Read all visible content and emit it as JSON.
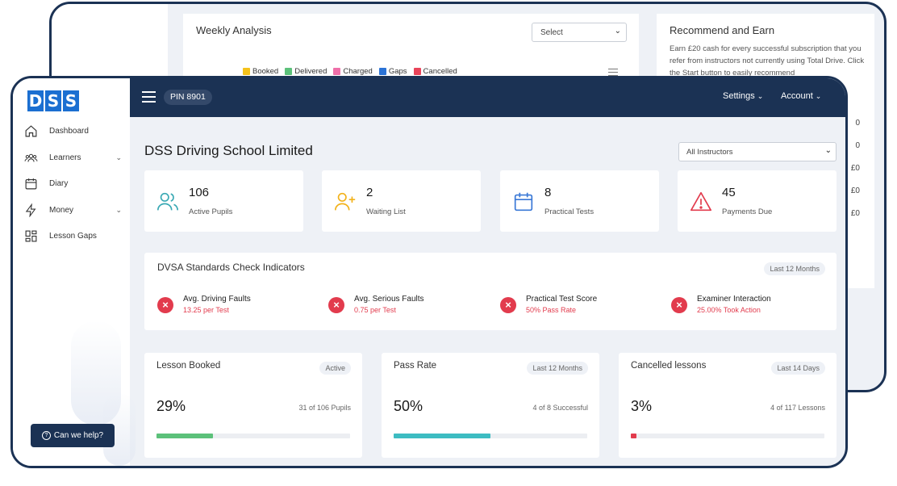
{
  "back": {
    "weekly": {
      "title": "Weekly Analysis",
      "select": "Select",
      "legend": [
        {
          "label": "Booked",
          "color": "#f5c21b"
        },
        {
          "label": "Delivered",
          "color": "#5cc17a"
        },
        {
          "label": "Charged",
          "color": "#ef6fa9"
        },
        {
          "label": "Gaps",
          "color": "#2b73d6"
        },
        {
          "label": "Cancelled",
          "color": "#e9445a"
        }
      ]
    },
    "recommend": {
      "title": "Recommend and Earn",
      "body": "Earn £20 cash for every successful subscription that you refer from instructors not currently using Total Drive. Click the Start button to easily recommend",
      "values": [
        "0",
        "0",
        "£0",
        "£0",
        "£0"
      ]
    }
  },
  "sidebar": {
    "logo": [
      "D",
      "S",
      "S"
    ],
    "items": [
      {
        "label": "Dashboard",
        "icon": "home-icon",
        "chevron": false
      },
      {
        "label": "Learners",
        "icon": "users-icon",
        "chevron": true
      },
      {
        "label": "Diary",
        "icon": "calendar-icon",
        "chevron": false
      },
      {
        "label": "Money",
        "icon": "lightning-icon",
        "chevron": true
      },
      {
        "label": "Lesson Gaps",
        "icon": "grid-icon",
        "chevron": false
      }
    ],
    "help": "Can we help?"
  },
  "topbar": {
    "pin": "PIN 8901",
    "settings": "Settings",
    "account": "Account"
  },
  "main": {
    "title": "DSS Driving School Limited",
    "instructor_select": "All Instructors",
    "stats": [
      {
        "value": "106",
        "label": "Active Pupils",
        "icon": "users-icon",
        "color": "#3aa9b4"
      },
      {
        "value": "2",
        "label": "Waiting List",
        "icon": "user-plus-icon",
        "color": "#f2b21b"
      },
      {
        "value": "8",
        "label": "Practical Tests",
        "icon": "calendar-icon",
        "color": "#3a78d6"
      },
      {
        "value": "45",
        "label": "Payments Due",
        "icon": "warning-icon",
        "color": "#e23b4d"
      }
    ],
    "dvsa": {
      "title": "DVSA Standards Check Indicators",
      "period": "Last 12 Months",
      "indicators": [
        {
          "label": "Avg. Driving Faults",
          "value": "13.25 per Test"
        },
        {
          "label": "Avg. Serious Faults",
          "value": "0.75 per Test"
        },
        {
          "label": "Practical Test Score",
          "value": "50% Pass Rate"
        },
        {
          "label": "Examiner Interaction",
          "value": "25.00% Took Action"
        }
      ]
    },
    "metrics": [
      {
        "title": "Lesson Booked",
        "badge": "Active",
        "percent": "29%",
        "detail": "31 of 106 Pupils",
        "fill": 0.29,
        "color": "#5cc17a"
      },
      {
        "title": "Pass Rate",
        "badge": "Last 12 Months",
        "percent": "50%",
        "detail": "4 of 8 Successful",
        "fill": 0.5,
        "color": "#3dbcc2"
      },
      {
        "title": "Cancelled lessons",
        "badge": "Last 14 Days",
        "percent": "3%",
        "detail": "4 of 117 Lessons",
        "fill": 0.03,
        "color": "#e23b4d"
      }
    ]
  }
}
